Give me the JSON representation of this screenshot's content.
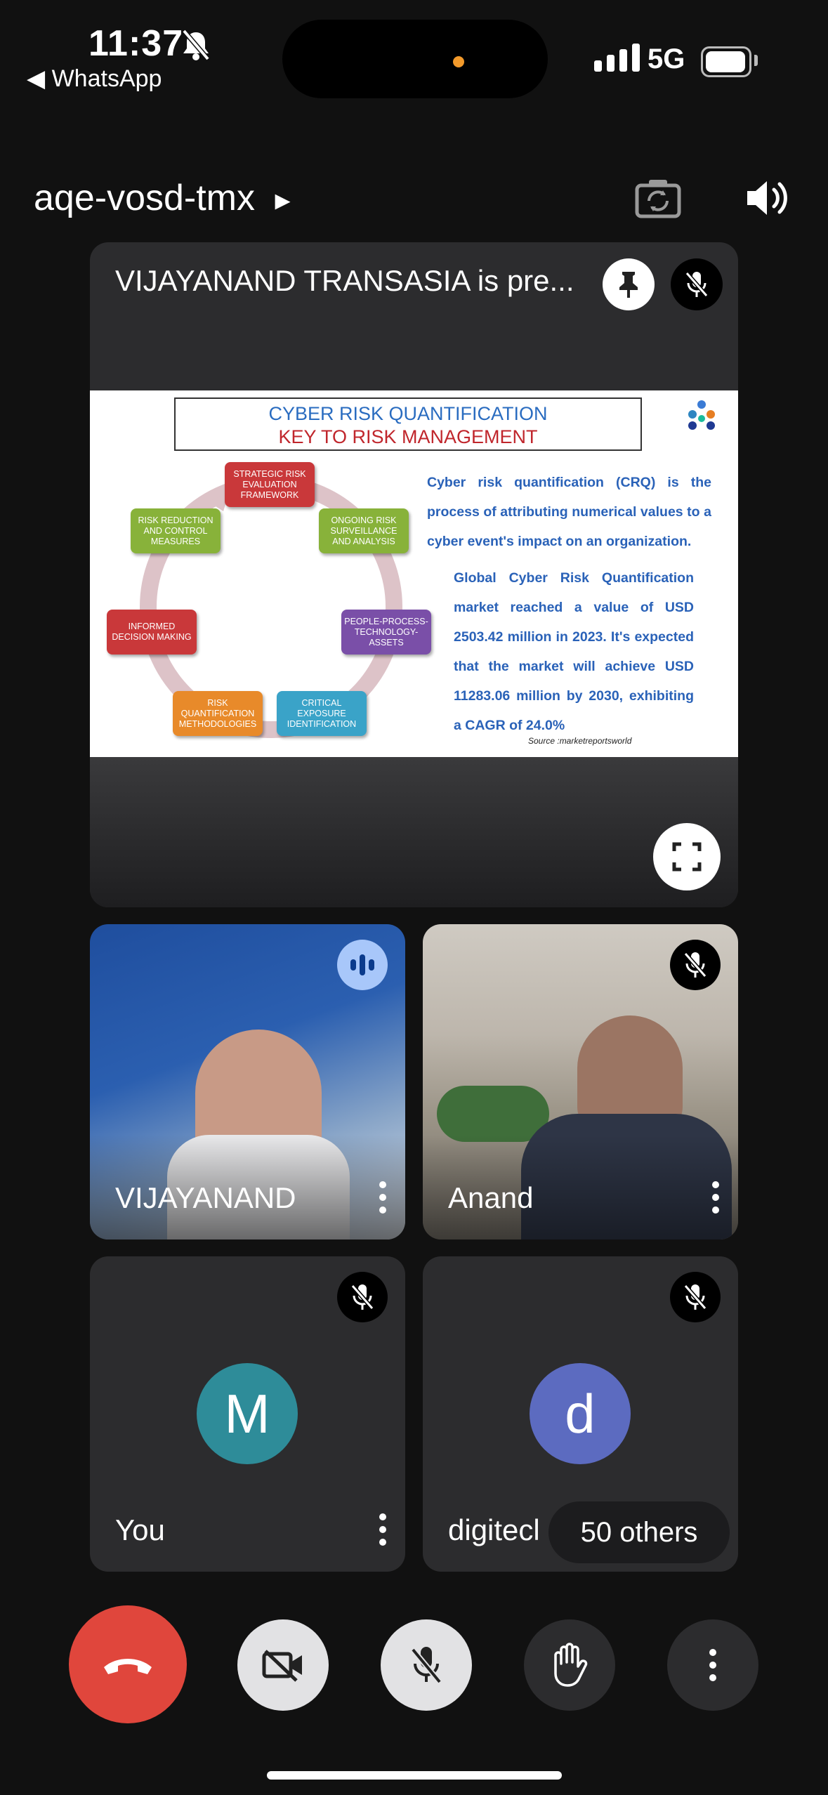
{
  "status_bar": {
    "time": "11:37",
    "back_label": "◀ WhatsApp",
    "network": "5G"
  },
  "header": {
    "meeting_code": "aqe-vosd-tmx",
    "chevron": "▸"
  },
  "presentation": {
    "title": "VIJAYANAND TRANSASIA is pre...",
    "slide": {
      "heading_line1": "CYBER RISK QUANTIFICATION",
      "heading_line2": "KEY TO RISK MANAGEMENT",
      "cycle": [
        {
          "label": "STRATEGIC RISK EVALUATION FRAMEWORK",
          "color": "#c9383a"
        },
        {
          "label": "ONGOING RISK SURVEILLANCE AND ANALYSIS",
          "color": "#88b23a"
        },
        {
          "label": "PEOPLE-PROCESS-TECHNOLOGY-ASSETS",
          "color": "#7a4fa8"
        },
        {
          "label": "CRITICAL EXPOSURE IDENTIFICATION",
          "color": "#3aa3c8"
        },
        {
          "label": "RISK QUANTIFICATION METHODOLOGIES",
          "color": "#e88a2a"
        },
        {
          "label": "INFORMED DECISION MAKING",
          "color": "#c9383a"
        },
        {
          "label": "RISK REDUCTION AND CONTROL MEASURES",
          "color": "#88b23a"
        }
      ],
      "paragraph1": "Cyber risk quantification (CRQ) is the process of attributing numerical values to a cyber event's impact on an organization.",
      "paragraph2": "Global Cyber Risk Quantification market reached a value of USD 2503.42 million in 2023. It's expected that the market will achieve USD 11283.06 million by 2030, exhibiting a CAGR of 24.0%",
      "source": "Source :marketreportsworld"
    }
  },
  "participants": [
    {
      "name": "VIJAYANAND",
      "state": "speaking"
    },
    {
      "name": "Anand",
      "state": "muted"
    },
    {
      "name": "You",
      "avatar_letter": "M",
      "avatar_color": "#2e8c99",
      "state": "muted"
    },
    {
      "name": "digitecl",
      "avatar_letter": "d",
      "avatar_color": "#5c6bc0",
      "state": "muted"
    }
  ],
  "others_label": "50 others",
  "colors": {
    "end_call": "#e0463c",
    "background": "#111111",
    "tile": "#2c2c2e"
  },
  "controls": [
    "end-call",
    "camera-off",
    "mic-off",
    "raise-hand",
    "more-options"
  ]
}
